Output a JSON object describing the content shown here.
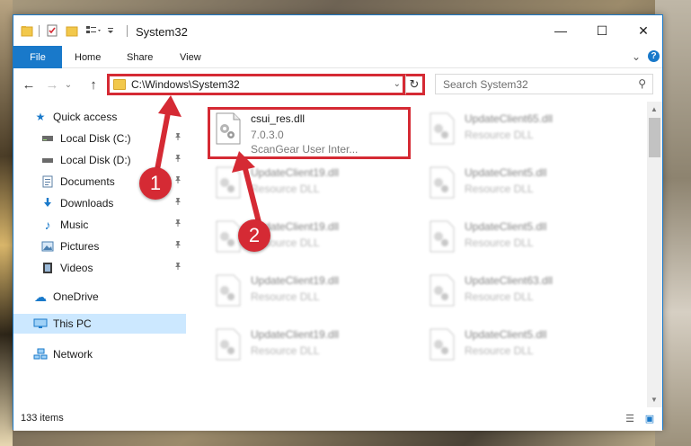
{
  "window": {
    "title": "System32",
    "minimize_glyph": "—",
    "maximize_glyph": "☐",
    "close_glyph": "✕"
  },
  "ribbon": {
    "tabs": [
      "File",
      "Home",
      "Share",
      "View"
    ],
    "expand_glyph": "⌄",
    "help_glyph": "?"
  },
  "navigation": {
    "back_glyph": "←",
    "forward_glyph": "→",
    "recent_glyph": "⌄",
    "up_glyph": "↑",
    "address_path": "C:\\Windows\\System32",
    "address_dropdown_glyph": "⌄",
    "refresh_glyph": "↻",
    "search_placeholder": "Search System32",
    "search_glyph": "⚲"
  },
  "sidebar": {
    "items": [
      {
        "label": "Quick access",
        "icon": "star-icon",
        "glyph": "★",
        "color": "#1979ca",
        "pinned": false
      },
      {
        "label": "Local Disk (C:)",
        "icon": "drive-icon",
        "glyph": "▬",
        "color": "#4a4a4a",
        "pinned": true
      },
      {
        "label": "Local Disk (D:)",
        "icon": "drive-icon",
        "glyph": "▬",
        "color": "#4a4a4a",
        "pinned": true
      },
      {
        "label": "Documents",
        "icon": "documents-icon",
        "glyph": "▤",
        "color": "#5b7fa6",
        "pinned": true
      },
      {
        "label": "Downloads",
        "icon": "downloads-icon",
        "glyph": "↓",
        "color": "#1979ca",
        "pinned": true
      },
      {
        "label": "Music",
        "icon": "music-icon",
        "glyph": "♪",
        "color": "#1979ca",
        "pinned": true
      },
      {
        "label": "Pictures",
        "icon": "pictures-icon",
        "glyph": "▣",
        "color": "#4a7fb0",
        "pinned": true
      },
      {
        "label": "Videos",
        "icon": "videos-icon",
        "glyph": "▦",
        "color": "#3b3b3b",
        "pinned": true
      },
      {
        "label": "OneDrive",
        "icon": "onedrive-icon",
        "glyph": "☁",
        "color": "#1979ca",
        "pinned": false
      },
      {
        "label": "This PC",
        "icon": "this-pc-icon",
        "glyph": "▭",
        "color": "#1979ca",
        "pinned": false
      },
      {
        "label": "Network",
        "icon": "network-icon",
        "glyph": "⬚",
        "color": "#1979ca",
        "pinned": false
      }
    ],
    "pin_glyph": "📌"
  },
  "files": [
    {
      "name": "csui_res.dll",
      "line2": "7.0.3.0",
      "line3": "ScanGear User Inter...",
      "highlighted": true
    },
    {
      "name": "UpdateClient65.dll",
      "line2": "Resource DLL",
      "line3": "",
      "highlighted": false
    },
    {
      "name": "UpdateClient19.dll",
      "line2": "Resource DLL",
      "line3": "",
      "highlighted": false
    },
    {
      "name": "UpdateClient5.dll",
      "line2": "Resource DLL",
      "line3": "",
      "highlighted": false
    },
    {
      "name": "UpdateClient19.dll",
      "line2": "Resource DLL",
      "line3": "",
      "highlighted": false
    },
    {
      "name": "UpdateClient5.dll",
      "line2": "Resource DLL",
      "line3": "",
      "highlighted": false
    },
    {
      "name": "UpdateClient19.dll",
      "line2": "Resource DLL",
      "line3": "",
      "highlighted": false
    },
    {
      "name": "UpdateClient63.dll",
      "line2": "Resource DLL",
      "line3": "",
      "highlighted": false
    },
    {
      "name": "UpdateClient19.dll",
      "line2": "Resource DLL",
      "line3": "",
      "highlighted": false
    },
    {
      "name": "UpdateClient5.dll",
      "line2": "Resource DLL",
      "line3": "",
      "highlighted": false
    }
  ],
  "status": {
    "item_count": "133 items",
    "details_view_glyph": "☰",
    "icons_view_glyph": "▣"
  },
  "annotations": [
    {
      "number": "1",
      "target": "address bar"
    },
    {
      "number": "2",
      "target": "csui_res.dll"
    }
  ],
  "colors": {
    "accent": "#1979ca",
    "annotation_red": "#d52a34",
    "selection": "#cce8ff"
  }
}
